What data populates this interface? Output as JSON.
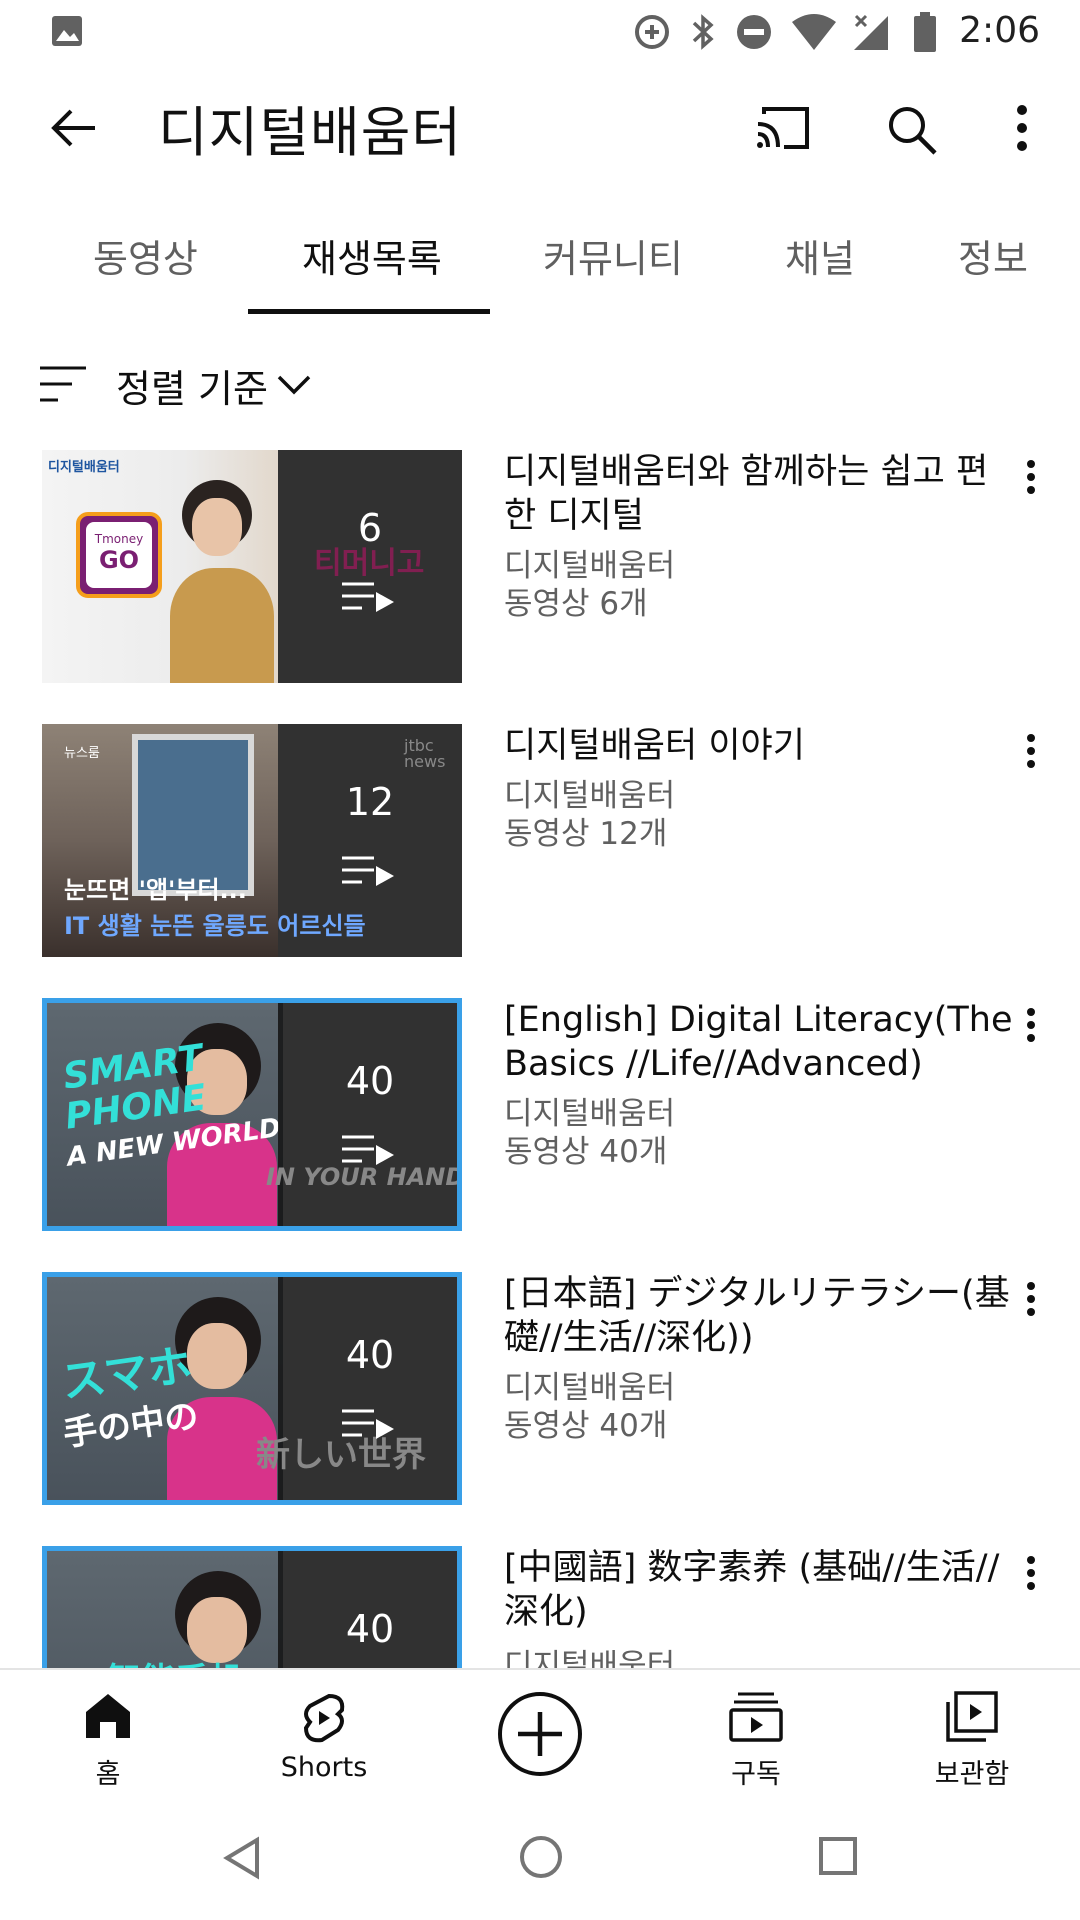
{
  "status_bar": {
    "time": "2:06"
  },
  "app_bar": {
    "title": "디지털배움터"
  },
  "tabs": [
    {
      "label": "동영상"
    },
    {
      "label": "재생목록"
    },
    {
      "label": "커뮤니티"
    },
    {
      "label": "채널"
    },
    {
      "label": "정보"
    }
  ],
  "active_tab": "재생목록",
  "sort": {
    "label": "정렬 기준"
  },
  "playlists": [
    {
      "title": "디지털배움터와 함께하는 쉽고 편한 디지털",
      "channel": "디지털배움터",
      "video_count": "동영상 6개",
      "thumb_count": "6",
      "thumb": {
        "logo_text": "디지털배움터",
        "badge_top": "Tmoney",
        "badge_bottom": "GO",
        "behind_text": "티머니고"
      }
    },
    {
      "title": "디지털배움터 이야기",
      "channel": "디지털배움터",
      "video_count": "동영상 12개",
      "thumb_count": "12",
      "thumb": {
        "corner_label": "뉴스룸",
        "brand": "jtbc news",
        "caption_1": "눈뜨면 '앱'부터...",
        "caption_2": "IT 생활 눈뜬 울릉도 어르신들"
      }
    },
    {
      "title": "[English] Digital Literacy(The Basics //Life//Advanced)",
      "channel": "디지털배움터",
      "video_count": "동영상 40개",
      "thumb_count": "40",
      "thumb": {
        "line_1": "SMART",
        "line_2": "PHONE",
        "line_3": "A NEW WORLD",
        "line_4": "IN YOUR HAND"
      }
    },
    {
      "title": "[日本語] デジタルリテラシー(基礎//生活//深化))",
      "channel": "디지털배움터",
      "video_count": "동영상 40개",
      "thumb_count": "40",
      "thumb": {
        "line_1": "スマホ",
        "line_2": "手の中の",
        "line_3": "新しい世界"
      }
    },
    {
      "title": "[中國語] 数字素养 (基础//生活//深化)",
      "channel": "디지털배움터",
      "video_count": "",
      "thumb_count": "40",
      "thumb": {
        "line_1": "智能手机"
      }
    }
  ],
  "bottom_nav": [
    {
      "label": "홈",
      "icon": "home-icon"
    },
    {
      "label": "Shorts",
      "icon": "shorts-icon"
    },
    {
      "label": "",
      "icon": "create-icon"
    },
    {
      "label": "구독",
      "icon": "subscriptions-icon"
    },
    {
      "label": "보관함",
      "icon": "library-icon"
    }
  ],
  "colors": {
    "accent_text": "#0f0f0f",
    "secondary_text": "#606060",
    "divider": "#e4e4e4"
  }
}
